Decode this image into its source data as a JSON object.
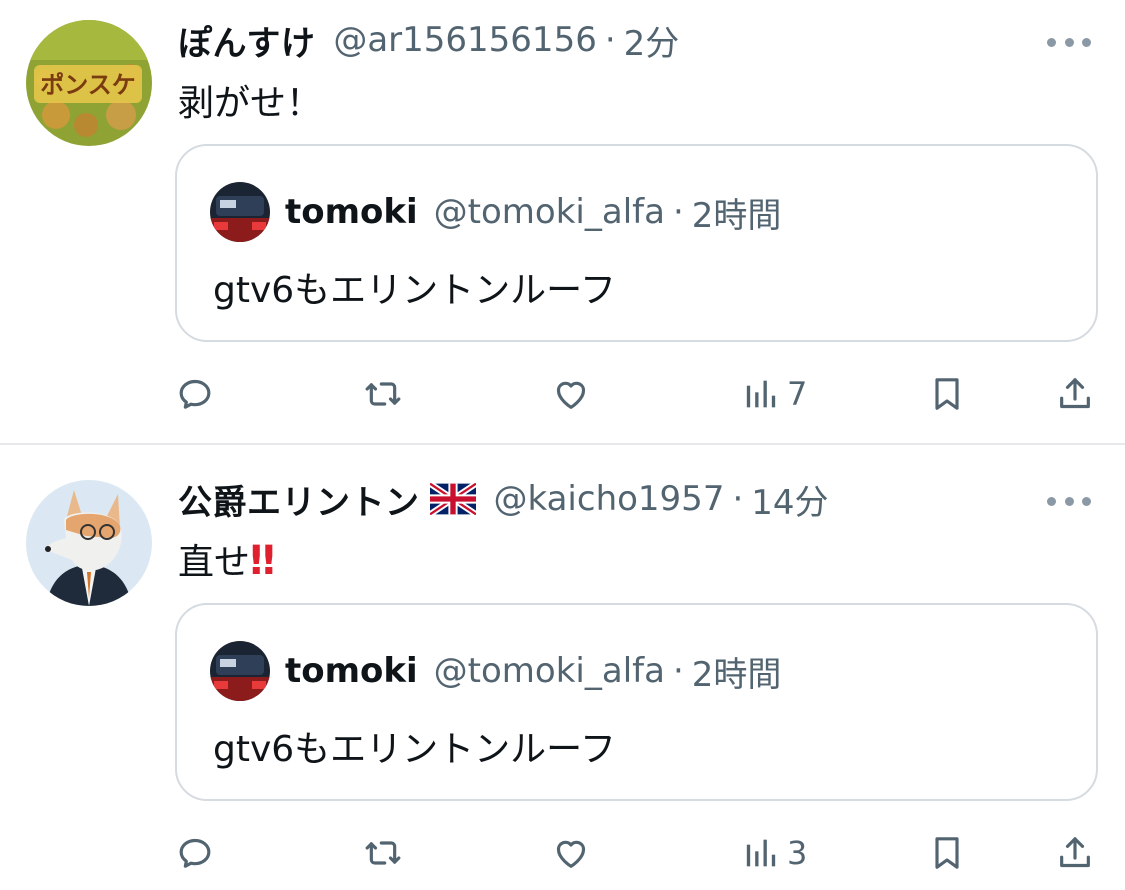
{
  "tweets": [
    {
      "display_name": "ぽんすけ",
      "handle": "@ar156156156",
      "separator": "·",
      "time": "2分",
      "text": "剥がせ！",
      "avatar_icon": "snack-package-avatar",
      "quote": {
        "display_name": "tomoki",
        "handle": "@tomoki_alfa",
        "separator": "·",
        "time": "2時間",
        "text": "gtv6もエリントンルーフ",
        "avatar_icon": "car-avatar"
      },
      "views": "7"
    },
    {
      "display_name": "公爵エリントン",
      "name_emoji": "uk-flag-icon",
      "handle": "@kaicho1957",
      "separator": "·",
      "time": "14分",
      "text": "直せ",
      "text_emoji": "‼",
      "avatar_icon": "fox-in-suit-avatar",
      "quote": {
        "display_name": "tomoki",
        "handle": "@tomoki_alfa",
        "separator": "·",
        "time": "2時間",
        "text": "gtv6もエリントンルーフ",
        "avatar_icon": "car-avatar"
      },
      "views": "3"
    }
  ],
  "colors": {
    "text_primary": "#0f1419",
    "text_secondary": "#536471",
    "border": "#d5dbe0",
    "emoji_red": "#e0202e"
  }
}
